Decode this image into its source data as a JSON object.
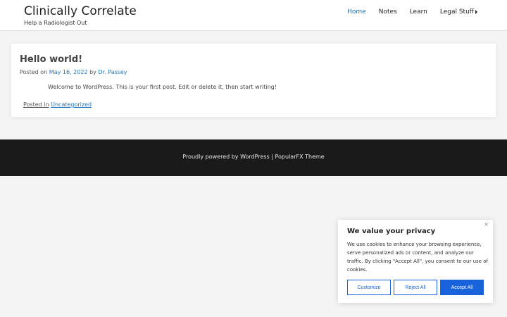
{
  "header": {
    "title": "Clinically Correlate",
    "tagline": "Help a Radiologist Out",
    "nav": [
      "Home",
      "Notes",
      "Learn",
      "Legal Stuff"
    ]
  },
  "post": {
    "title": "Hello world!",
    "posted_on": "Posted on",
    "date": "May 16, 2022",
    "by": "by",
    "author": "Dr. Passey",
    "content": "Welcome to WordPress. This is your first post. Edit or delete it, then start writing!",
    "posted_in": "Posted in",
    "category": "Uncategorized"
  },
  "footer": {
    "text": "Proudly powered by WordPress | PopularFX Theme"
  },
  "cookie": {
    "title": "We value your privacy",
    "text": "We use cookies to enhance your browsing experience, serve personalized ads or content, and analyze our traffic. By clicking \"Accept All\", you consent to our use of cookies.",
    "close": "×",
    "customize": "Customize",
    "reject": "Reject All",
    "accept": "Accept All"
  },
  "colors": {
    "accent": "#1e73be",
    "cookie_accent": "#1863dc",
    "footer_bg": "#1a1a1a"
  }
}
